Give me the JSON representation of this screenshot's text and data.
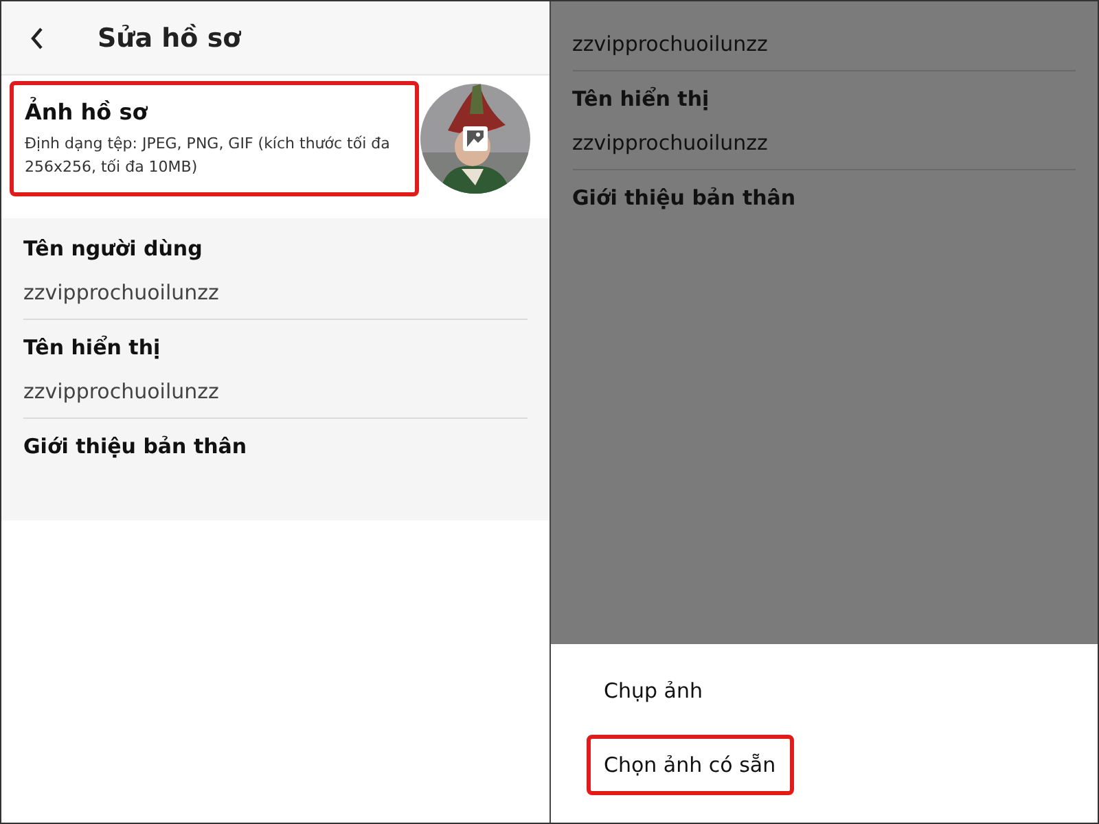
{
  "left_screen": {
    "header": {
      "title": "Sửa hồ sơ"
    },
    "profile_photo": {
      "label": "Ảnh hồ sơ",
      "hint": "Định dạng tệp: JPEG, PNG, GIF (kích thước tối đa 256x256, tối đa 10MB)",
      "highlighted": true
    },
    "fields": [
      {
        "label": "Tên người dùng",
        "value": "zzvipprochuoilunzz"
      },
      {
        "label": "Tên hiển thị",
        "value": "zzvipprochuoilunzz"
      },
      {
        "label": "Giới thiệu bản thân"
      }
    ]
  },
  "right_screen": {
    "dimmed": true,
    "fields": [
      {
        "value": "zzvipprochuoilunzz"
      },
      {
        "label": "Tên hiển thị",
        "value": "zzvipprochuoilunzz"
      },
      {
        "label": "Giới thiệu bản thân"
      }
    ],
    "sheet": {
      "options": [
        {
          "label": "Chụp ảnh",
          "highlighted": false
        },
        {
          "label": "Chọn ảnh có sẵn",
          "highlighted": true
        }
      ]
    }
  }
}
